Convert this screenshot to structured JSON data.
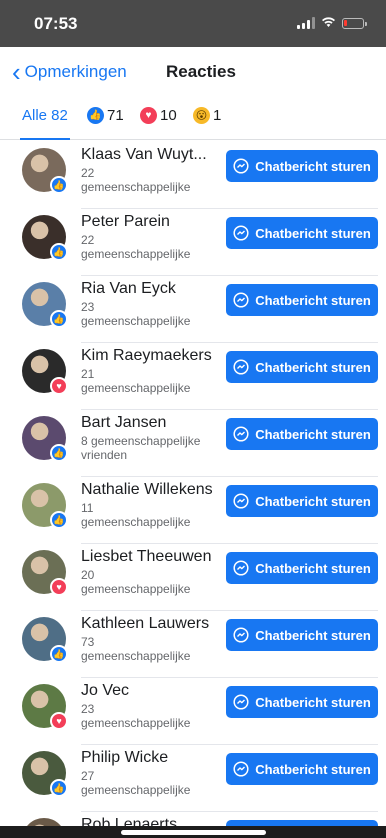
{
  "status": {
    "time": "07:53"
  },
  "nav": {
    "back_label": "Opmerkingen",
    "title": "Reacties"
  },
  "tabs": {
    "all": "Alle 82",
    "like_count": "71",
    "love_count": "10",
    "wow_count": "1"
  },
  "colors": {
    "accent": "#1877f2",
    "love": "#f33e58",
    "wow": "#f7b928"
  },
  "people": [
    {
      "name": "Klaas Van Wuyt...",
      "mutual_line1": "22",
      "mutual_line2": "gemeenschappelijke",
      "reaction": "like",
      "button": "Chatbericht sturen"
    },
    {
      "name": "Peter Parein",
      "mutual_line1": "22",
      "mutual_line2": "gemeenschappelijke",
      "reaction": "like",
      "button": "Chatbericht sturen"
    },
    {
      "name": "Ria Van Eyck",
      "mutual_line1": "23",
      "mutual_line2": "gemeenschappelijke",
      "reaction": "like",
      "button": "Chatbericht sturen"
    },
    {
      "name": "Kim Raeymaekers",
      "mutual_line1": "21",
      "mutual_line2": "gemeenschappelijke",
      "reaction": "love",
      "button": "Chatbericht sturen"
    },
    {
      "name": "Bart Jansen",
      "mutual_line1": "8 gemeenschappelijke",
      "mutual_line2": "vrienden",
      "reaction": "like",
      "button": "Chatbericht sturen"
    },
    {
      "name": "Nathalie Willekens",
      "mutual_line1": "11",
      "mutual_line2": "gemeenschappelijke",
      "reaction": "like",
      "button": "Chatbericht sturen"
    },
    {
      "name": "Liesbet Theeuwen",
      "mutual_line1": "20",
      "mutual_line2": "gemeenschappelijke",
      "reaction": "love",
      "button": "Chatbericht sturen"
    },
    {
      "name": "Kathleen Lauwers",
      "mutual_line1": "73",
      "mutual_line2": "gemeenschappelijke",
      "reaction": "like",
      "button": "Chatbericht sturen"
    },
    {
      "name": "Jo Vec",
      "mutual_line1": "23",
      "mutual_line2": "gemeenschappelijke",
      "reaction": "love",
      "button": "Chatbericht sturen"
    },
    {
      "name": "Philip Wicke",
      "mutual_line1": "27",
      "mutual_line2": "gemeenschappelijke",
      "reaction": "like",
      "button": "Chatbericht sturen"
    },
    {
      "name": "Rob Lenaerts",
      "mutual_line1": "",
      "mutual_line2": "",
      "reaction": "like",
      "button": "Chatbericht sturen"
    }
  ]
}
